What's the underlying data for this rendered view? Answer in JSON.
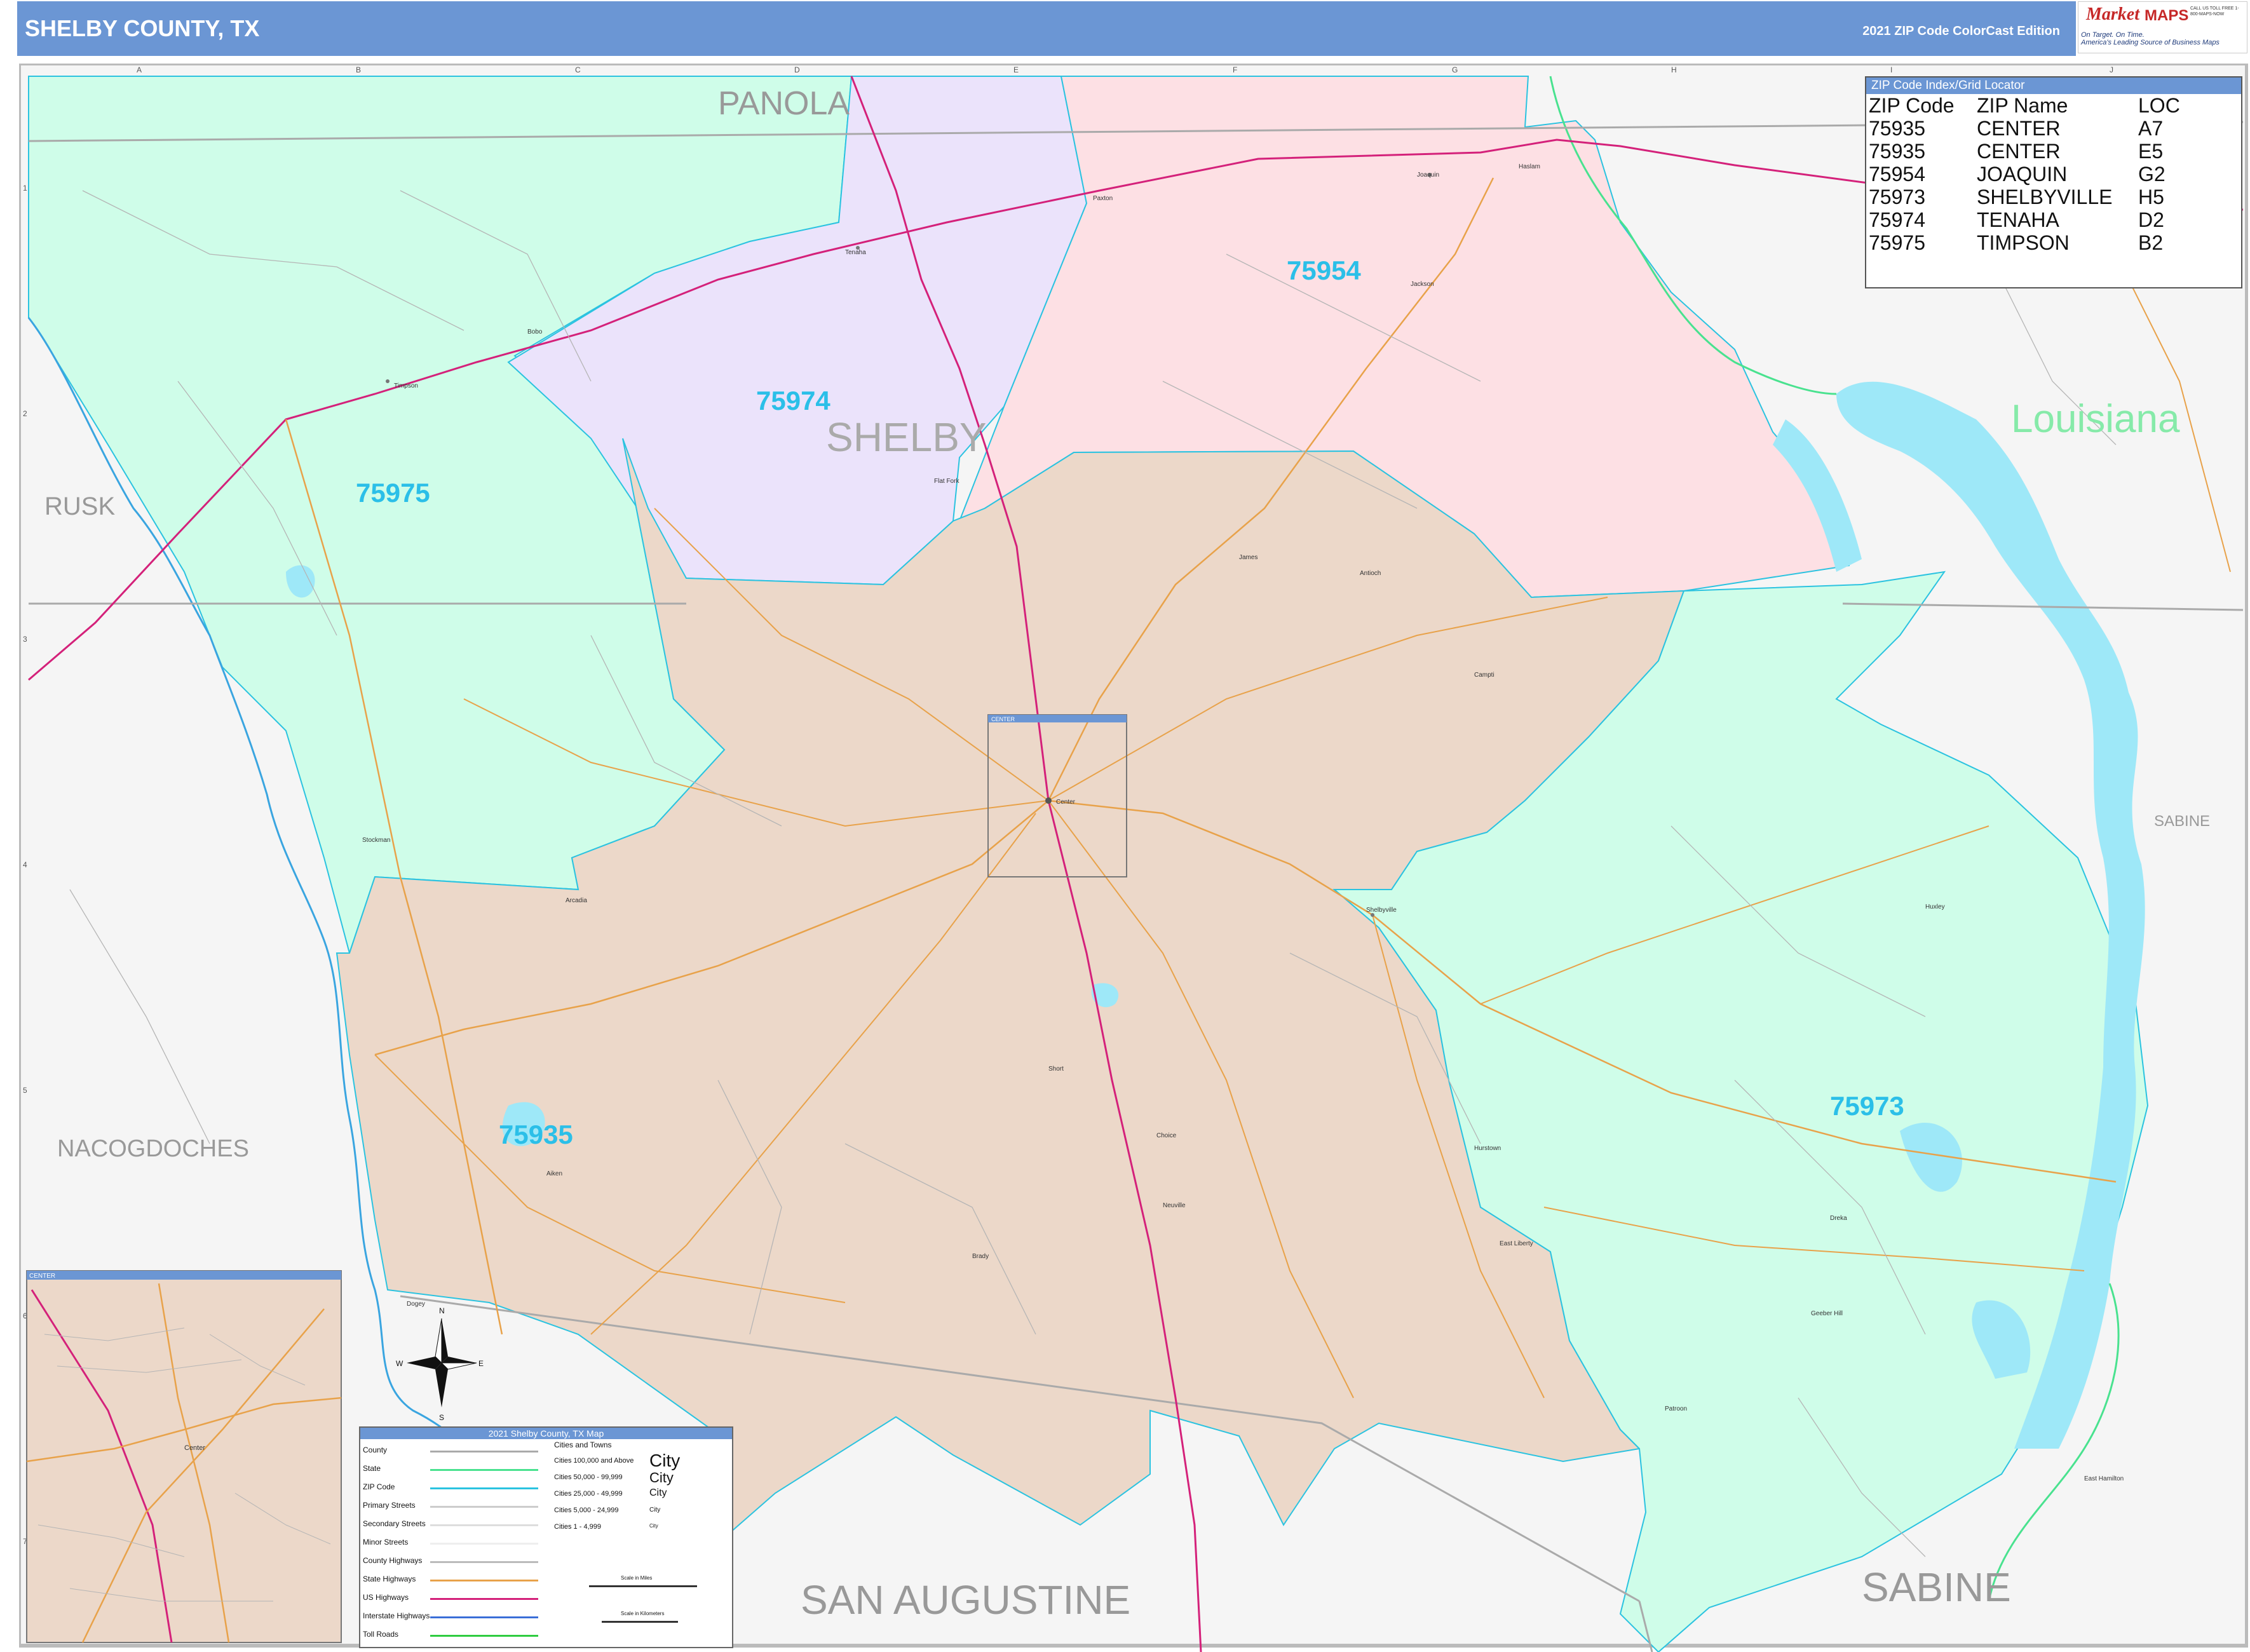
{
  "header": {
    "title": "SHELBY COUNTY, TX",
    "edition": "2021 ZIP Code ColorCast Edition"
  },
  "logo": {
    "brand_script": "Market",
    "brand_block": "MAPS",
    "tagline_1": "On Target. On Time.",
    "tagline_2": "America's Leading Source of Business Maps",
    "contact": "CALL US TOLL FREE 1-800-MAPS-NOW"
  },
  "map": {
    "neighbor_labels": {
      "panola": "PANOLA",
      "rusk": "RUSK",
      "nacogdoches": "NACOGDOCHES",
      "san_augustine": "SAN AUGUSTINE",
      "sabine_south": "SABINE",
      "sabine_east": "SABINE",
      "louisiana": "Louisiana",
      "shelby": "SHELBY"
    },
    "zip_labels": {
      "z75954": "75954",
      "z75974": "75974",
      "z75975": "75975",
      "z75935": "75935",
      "z75973": "75973"
    },
    "zip_colors": {
      "75954": "#fde0e4",
      "75974": "#ebe3fb",
      "75975": "#cffde9",
      "75935": "#ecd8c9",
      "75973": "#cffde9"
    },
    "water_color": "#9ee8f8",
    "grid_columns": [
      "A",
      "B",
      "C",
      "D",
      "E",
      "F",
      "G",
      "H",
      "I",
      "J"
    ],
    "grid_rows": [
      "1",
      "2",
      "3",
      "4",
      "5",
      "6",
      "7"
    ],
    "towns": {
      "tenaha": "Tenaha",
      "timpson": "Timpson",
      "joaquin": "Joaquin",
      "shelbyville": "Shelbyville",
      "center": "Center",
      "flat_fork": "Flat Fork",
      "stockman": "Stockman",
      "arcadia": "Arcadia",
      "jackson": "Jackson",
      "antioch": "Antioch",
      "james": "James",
      "campti": "Campti",
      "short": "Short",
      "choice": "Choice",
      "aiken": "Aiken",
      "neuville": "Neuville",
      "brady": "Brady",
      "huxley": "Huxley",
      "dreka": "Dreka",
      "hurstown": "Hurstown",
      "east_liberty": "East Liberty",
      "geneva_hill": "Geeber Hill",
      "patroon": "Patroon",
      "east_hamilton": "East Hamilton",
      "sabine_lake": "SABINE",
      "ringold": "Paxton",
      "haslam": "Haslam",
      "bobo": "Bobo",
      "dogey": "Dogey"
    },
    "center_box_label": "CENTER",
    "inset_label": "CENTER"
  },
  "zip_index": {
    "title": "ZIP Code Index/Grid Locator",
    "headers": [
      "ZIP Code",
      "ZIP Name",
      "LOC"
    ],
    "rows": [
      [
        "75935",
        "CENTER",
        "A7"
      ],
      [
        "75935",
        "CENTER",
        "E5"
      ],
      [
        "75954",
        "JOAQUIN",
        "G2"
      ],
      [
        "75973",
        "SHELBYVILLE",
        "H5"
      ],
      [
        "75974",
        "TENAHA",
        "D2"
      ],
      [
        "75975",
        "TIMPSON",
        "B2"
      ]
    ]
  },
  "legend": {
    "title": "2021 Shelby County, TX Map",
    "items": [
      "County",
      "State",
      "ZIP Code",
      "Primary Streets",
      "Secondary Streets",
      "Minor Streets",
      "County Highways",
      "State Highways",
      "US Highways",
      "Interstate Highways",
      "Toll Roads"
    ],
    "cities_title": "Cities and Towns",
    "city_classes": [
      "Cities 100,000 and Above",
      "Cities 50,000 - 99,999",
      "Cities 25,000 - 49,999",
      "Cities 5,000 - 24,999",
      "Cities 1 - 4,999"
    ],
    "city_samples": [
      "City",
      "City",
      "City",
      "City",
      "City"
    ],
    "scale_miles": "Scale in Miles",
    "scale_km": "Scale in Kilometers",
    "compass": {
      "n": "N",
      "s": "S",
      "e": "E",
      "w": "W"
    }
  }
}
